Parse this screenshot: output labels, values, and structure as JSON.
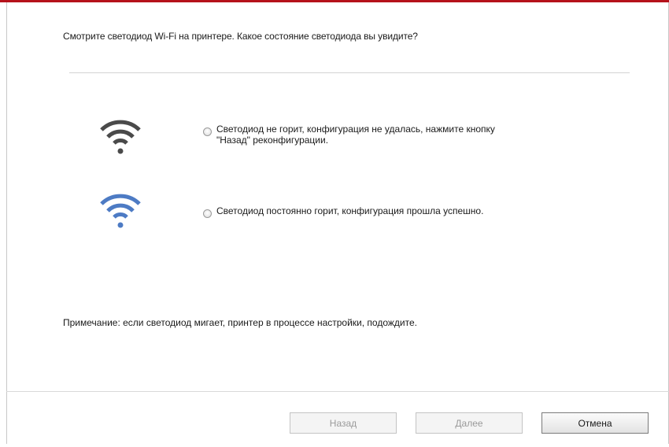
{
  "colors": {
    "accent_bar": "#b5121b",
    "wifi_off": "#4a4a4a",
    "wifi_on": "#4d7bc4"
  },
  "prompt": "Смотрите светодиод Wi-Fi на принтере. Какое состояние светодиода вы увидите?",
  "options": [
    {
      "icon": "wifi-gray-icon",
      "line1": "Светодиод не горит,  конфигурация не удалась, нажмите кнопку",
      "line2": "\"Назад\" реконфигурации.",
      "selected": false
    },
    {
      "icon": "wifi-blue-icon",
      "line1": "Светодиод постоянно горит, конфигурация прошла успешно.",
      "selected": false
    }
  ],
  "note": "Примечание: если светодиод мигает, принтер в процессе настройки, подождите.",
  "buttons": {
    "back": "Назад",
    "next": "Далее",
    "cancel": "Отмена"
  }
}
